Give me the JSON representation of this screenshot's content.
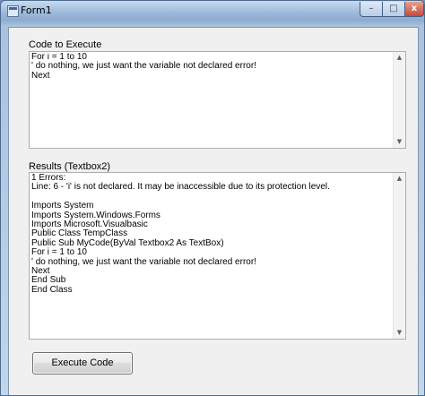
{
  "window": {
    "title": "Form1",
    "controls": {
      "minimize": "–",
      "maximize": "□",
      "close": "x"
    }
  },
  "code_section": {
    "label": "Code to Execute",
    "text": "For i = 1 to 10\n' do nothing, we just want the variable not declared error!\nNext"
  },
  "results_section": {
    "label": "Results (Textbox2)",
    "text": "1 Errors:\nLine: 6 - 'i' is not declared. It may be inaccessible due to its protection level.\n\nImports System\nImports System.Windows.Forms\nImports Microsoft.Visualbasic\nPublic Class TempClass\nPublic Sub MyCode(ByVal Textbox2 As TextBox)\nFor i = 1 to 10\n' do nothing, we just want the variable not declared error!\nNext\nEnd Sub\nEnd Class"
  },
  "scroll_arrows": {
    "up": "▲",
    "down": "▼"
  },
  "execute_button": {
    "label": "Execute Code"
  }
}
